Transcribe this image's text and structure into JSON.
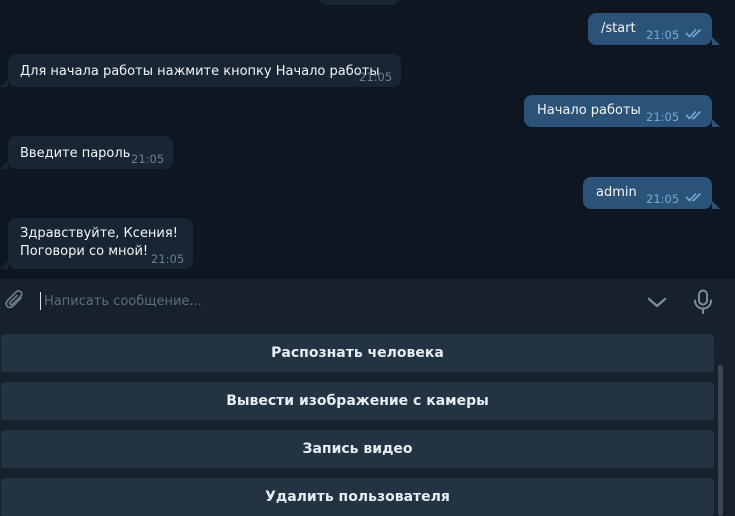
{
  "messages": [
    {
      "direction": "out",
      "text": "/start",
      "time": "21:05"
    },
    {
      "direction": "in",
      "text": "Для начала работы нажмите кнопку Начало работы",
      "time": "21:05"
    },
    {
      "direction": "out",
      "text": "Начало работы",
      "time": "21:05"
    },
    {
      "direction": "in",
      "text": "Введите пароль",
      "time": "21:05"
    },
    {
      "direction": "out",
      "text": "admin",
      "time": "21:05"
    },
    {
      "direction": "in",
      "lines": [
        "Здравствуйте, Ксения!",
        "Поговори со мной!"
      ],
      "time": "21:05"
    }
  ],
  "composer": {
    "placeholder": "Написать сообщение..."
  },
  "keyboard": {
    "buttons": [
      "Распознать человека",
      "Вывести изображение с камеры",
      "Запись видео",
      "Удалить пользователя"
    ]
  },
  "colors": {
    "background": "#0e1621",
    "incoming": "#182533",
    "outgoing": "#2b5278",
    "panel": "#17212b",
    "keyboard_button": "#243342"
  },
  "icons": [
    "double-check-icon",
    "paperclip-icon",
    "chevron-down-icon",
    "microphone-icon"
  ]
}
